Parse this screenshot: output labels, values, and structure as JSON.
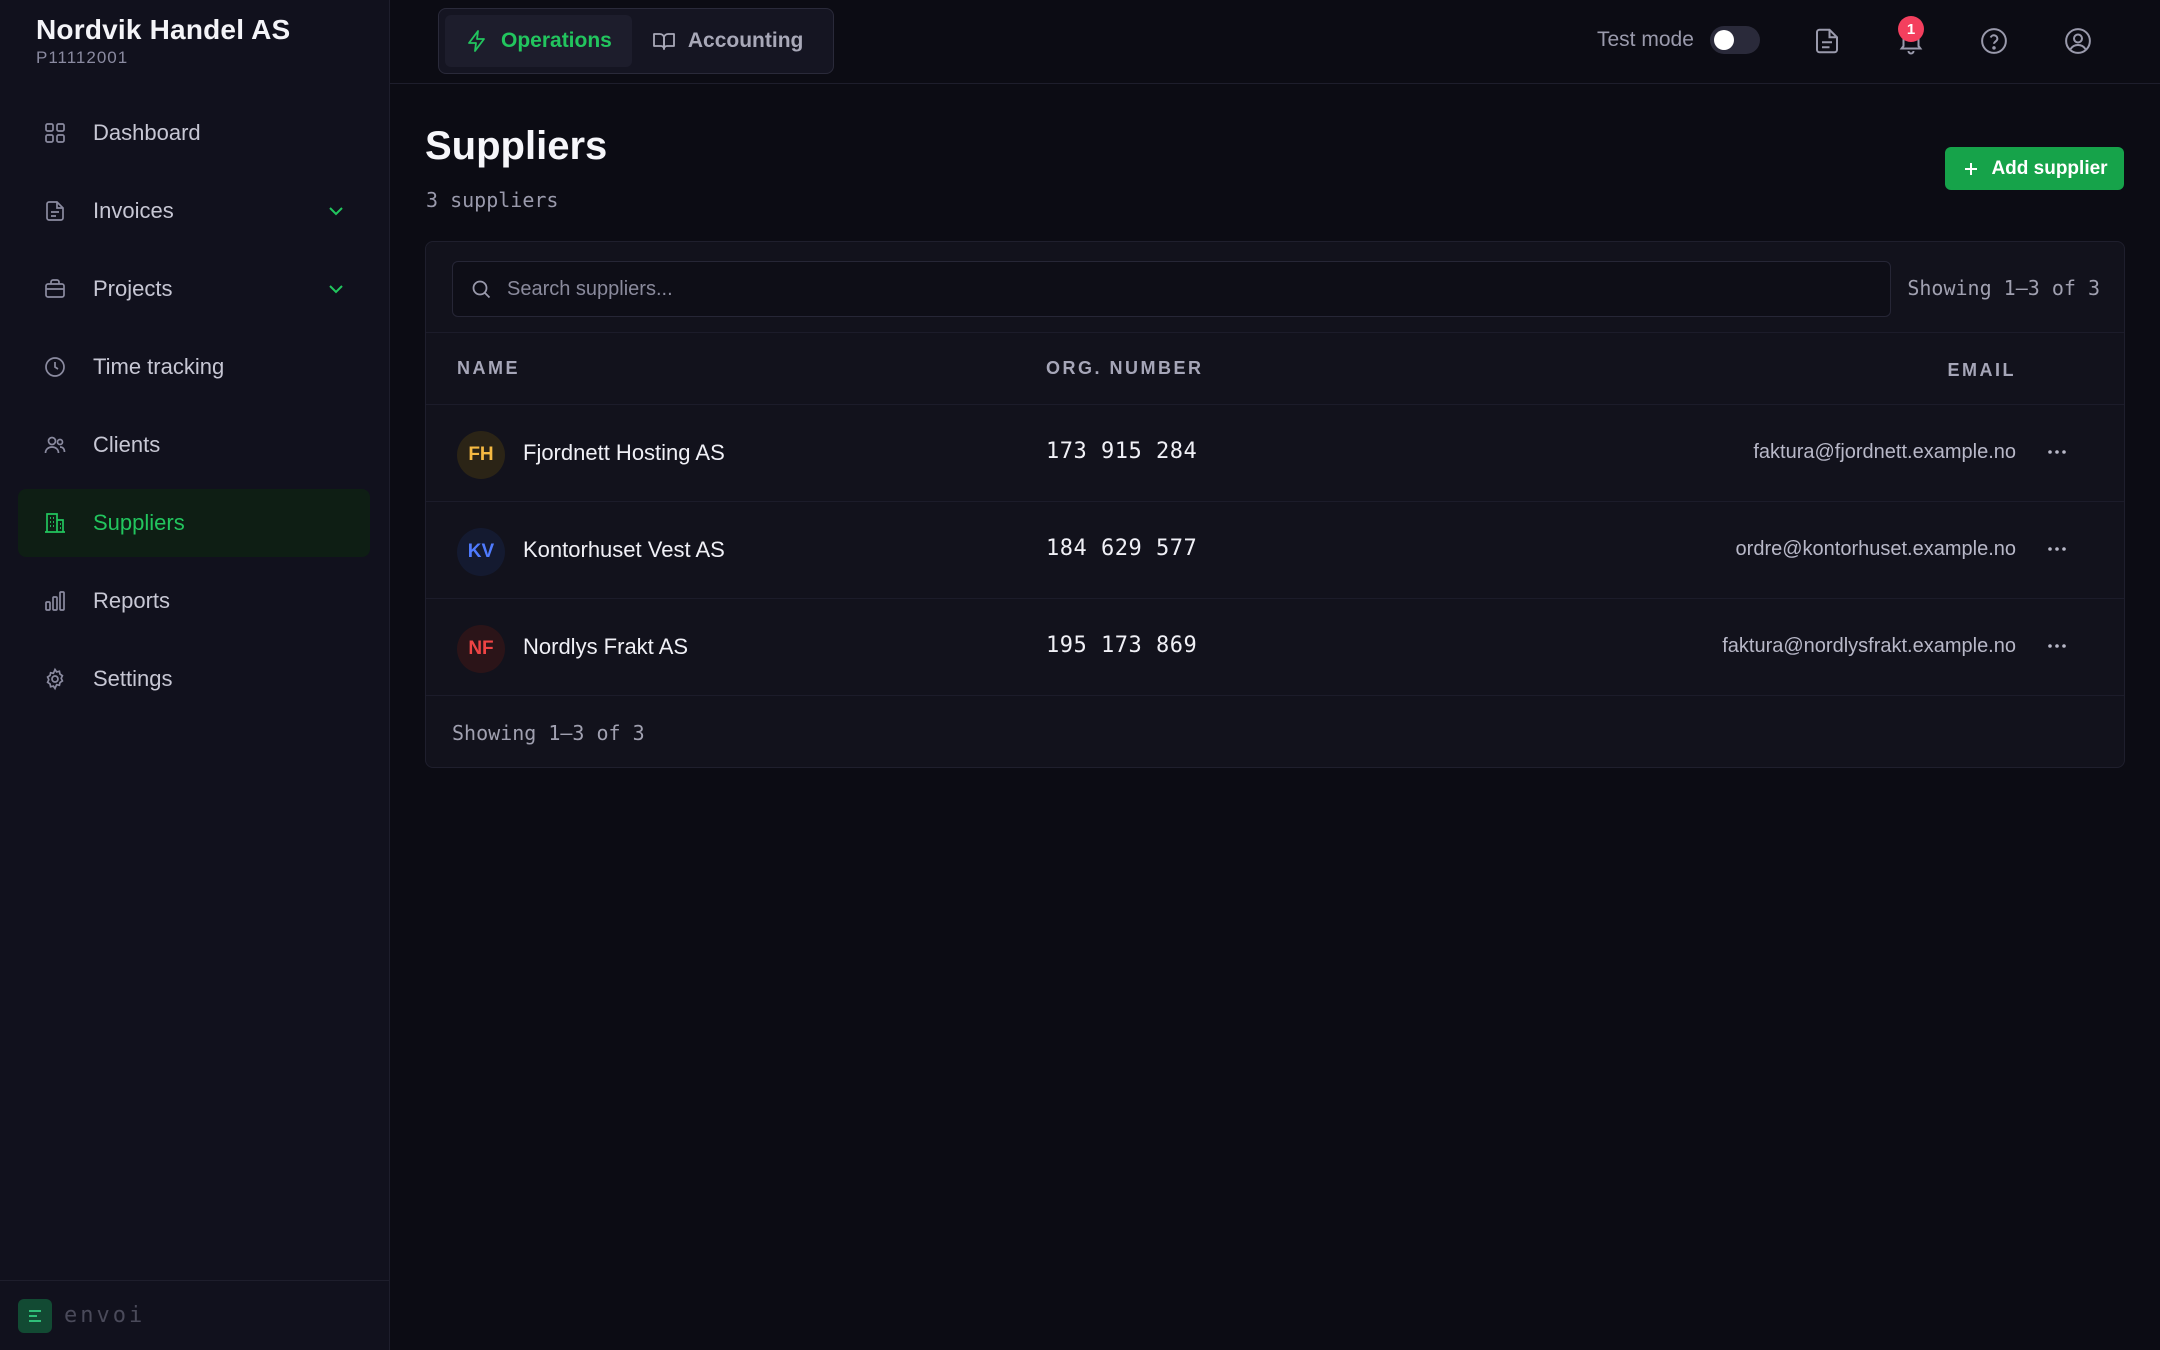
{
  "org": {
    "name": "Nordvik Handel AS",
    "id": "P11112001"
  },
  "sidebar": {
    "items": [
      {
        "label": "Dashboard",
        "icon": "grid-icon"
      },
      {
        "label": "Invoices",
        "icon": "file-icon",
        "expandable": true
      },
      {
        "label": "Projects",
        "icon": "briefcase-icon",
        "expandable": true
      },
      {
        "label": "Time tracking",
        "icon": "clock-icon"
      },
      {
        "label": "Clients",
        "icon": "users-icon"
      },
      {
        "label": "Suppliers",
        "icon": "building-icon",
        "active": true
      },
      {
        "label": "Reports",
        "icon": "bar-chart-icon"
      },
      {
        "label": "Settings",
        "icon": "gear-icon"
      }
    ],
    "brand": "envoi"
  },
  "topbar": {
    "tabs": [
      {
        "label": "Operations",
        "icon": "bolt-icon",
        "active": true
      },
      {
        "label": "Accounting",
        "icon": "book-icon"
      }
    ],
    "test_mode_label": "Test mode",
    "test_mode_on": false,
    "notification_count": "1"
  },
  "page": {
    "title": "Suppliers",
    "subtitle": "3 suppliers",
    "add_button": "Add supplier"
  },
  "search": {
    "placeholder": "Search suppliers..."
  },
  "pagination": {
    "top": "Showing 1–3 of 3",
    "bottom": "Showing 1–3 of 3"
  },
  "table": {
    "headers": {
      "name": "NAME",
      "org": "ORG. NUMBER",
      "email": "EMAIL"
    },
    "rows": [
      {
        "initials": "FH",
        "name": "Fjordnett Hosting AS",
        "org": "173 915 284",
        "email": "faktura@fjordnett.example.no"
      },
      {
        "initials": "KV",
        "name": "Kontorhuset Vest AS",
        "org": "184 629 577",
        "email": "ordre@kontorhuset.example.no"
      },
      {
        "initials": "NF",
        "name": "Nordlys Frakt AS",
        "org": "195 173 869",
        "email": "faktura@nordlysfrakt.example.no"
      }
    ]
  },
  "colors": {
    "accent": "#22c55e",
    "primary_button": "#16a34a",
    "badge": "#f43f5e",
    "avatar_fh": "#f5b942",
    "avatar_kv": "#4f7bff",
    "avatar_nf": "#ef4444"
  }
}
